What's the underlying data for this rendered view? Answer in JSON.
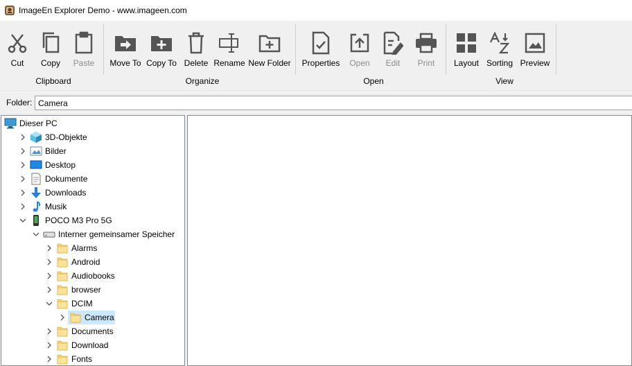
{
  "window": {
    "title": "ImageEn Explorer Demo - www.imageen.com"
  },
  "ribbon": {
    "buttons": {
      "cut": "Cut",
      "copy": "Copy",
      "paste": "Paste",
      "move_to": "Move To",
      "copy_to": "Copy To",
      "delete": "Delete",
      "rename": "Rename",
      "new_folder": "New Folder",
      "properties": "Properties",
      "open": "Open",
      "edit": "Edit",
      "print": "Print",
      "layout": "Layout",
      "sorting": "Sorting",
      "preview": "Preview"
    },
    "groups": {
      "clipboard": "Clipboard",
      "organize": "Organize",
      "open": "Open",
      "view": "View"
    },
    "disabled": [
      "paste",
      "open",
      "edit",
      "print"
    ]
  },
  "folderbar": {
    "label": "Folder:",
    "value": "Camera"
  },
  "tree": {
    "items": [
      {
        "label": "Dieser PC",
        "icon": "computer-icon",
        "expander": "none"
      },
      {
        "label": "3D-Objekte",
        "icon": "3d-objects-icon",
        "expander": "collapsed"
      },
      {
        "label": "Bilder",
        "icon": "pictures-icon",
        "expander": "collapsed"
      },
      {
        "label": "Desktop",
        "icon": "desktop-icon",
        "expander": "collapsed"
      },
      {
        "label": "Dokumente",
        "icon": "documents-icon",
        "expander": "collapsed"
      },
      {
        "label": "Downloads",
        "icon": "downloads-icon",
        "expander": "collapsed"
      },
      {
        "label": "Musik",
        "icon": "music-icon",
        "expander": "collapsed"
      },
      {
        "label": "POCO M3 Pro 5G",
        "icon": "phone-icon",
        "expander": "expanded"
      },
      {
        "label": "Interner gemeinsamer Speicher",
        "icon": "drive-icon",
        "expander": "expanded"
      },
      {
        "label": "Alarms",
        "icon": "folder-icon",
        "expander": "collapsed"
      },
      {
        "label": "Android",
        "icon": "folder-icon",
        "expander": "collapsed"
      },
      {
        "label": "Audiobooks",
        "icon": "folder-icon",
        "expander": "collapsed"
      },
      {
        "label": "browser",
        "icon": "folder-icon",
        "expander": "collapsed"
      },
      {
        "label": "DCIM",
        "icon": "folder-icon",
        "expander": "expanded"
      },
      {
        "label": "Camera",
        "icon": "folder-icon",
        "expander": "collapsed",
        "selected": true
      },
      {
        "label": "Documents",
        "icon": "folder-icon",
        "expander": "collapsed"
      },
      {
        "label": "Download",
        "icon": "folder-icon",
        "expander": "collapsed"
      },
      {
        "label": "Fonts",
        "icon": "folder-icon",
        "expander": "collapsed"
      }
    ]
  },
  "colors": {
    "selection": "#cce8ff",
    "icon_gray": "#555555",
    "folder": "#f7d674"
  }
}
